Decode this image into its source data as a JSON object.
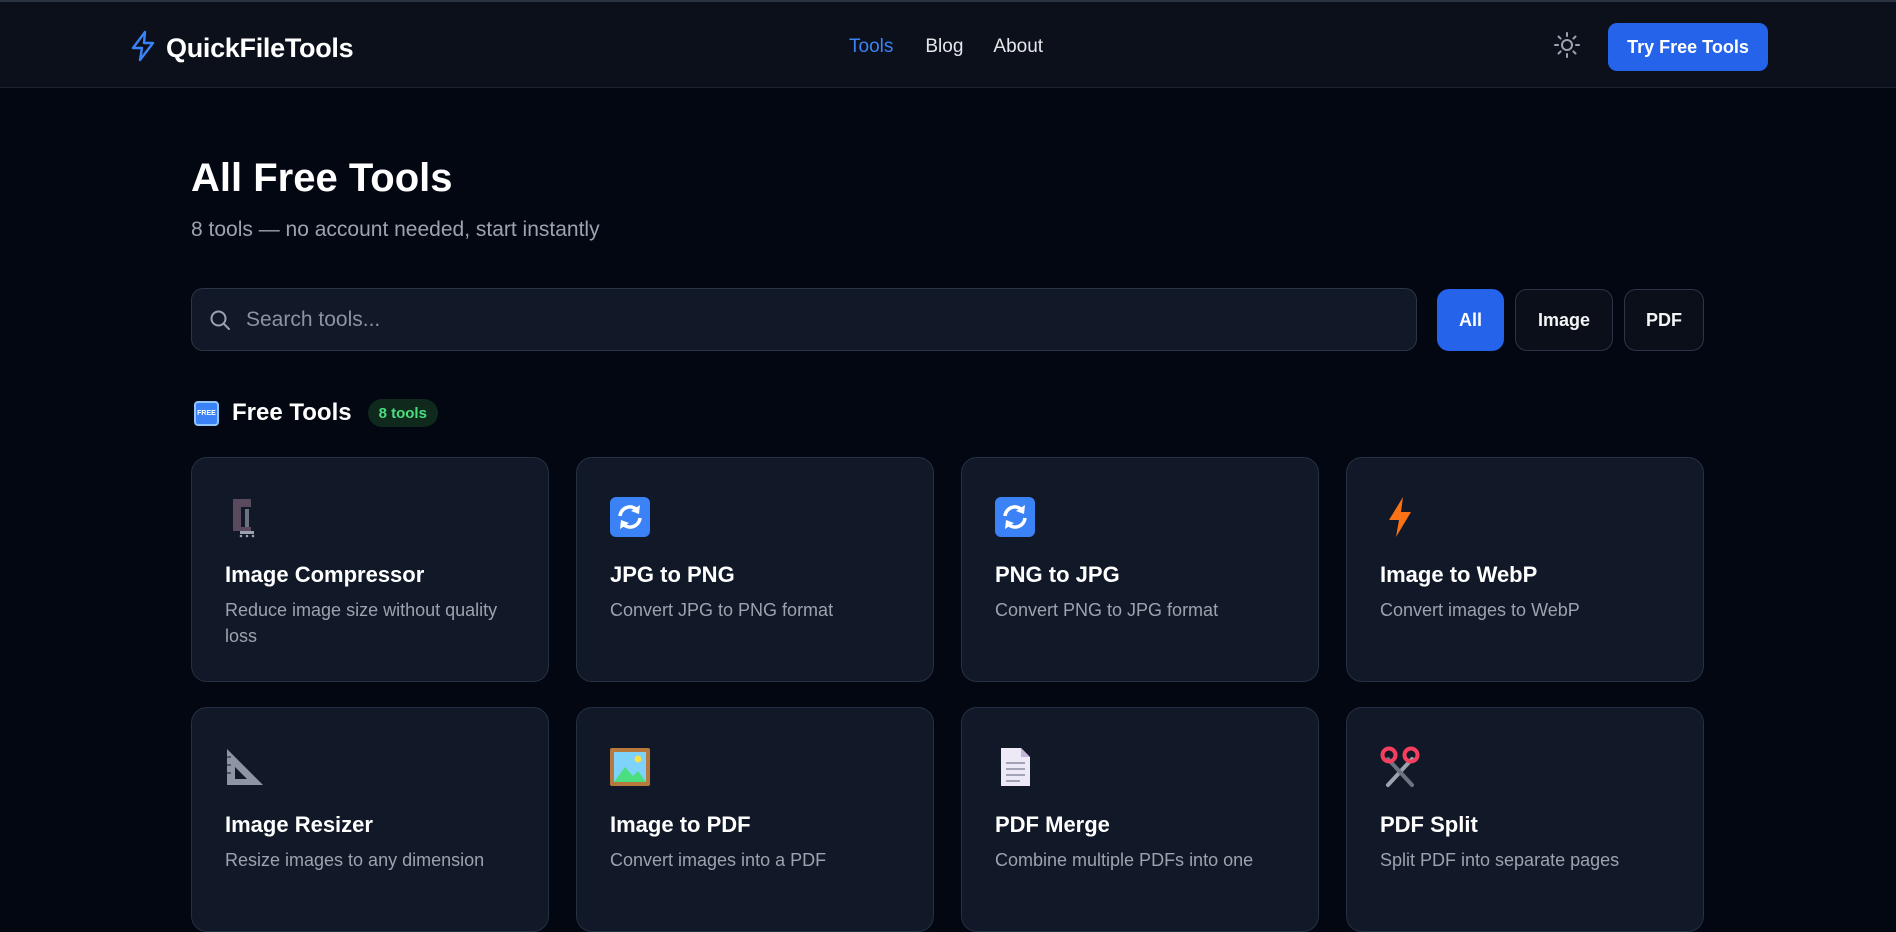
{
  "brand": {
    "name": "QuickFileTools",
    "accent": "#2563eb"
  },
  "nav": {
    "items": [
      "Tools",
      "Blog",
      "About"
    ],
    "active": "Tools"
  },
  "header": {
    "cta_label": "Try Free Tools",
    "theme_icon": "sun-icon"
  },
  "page": {
    "title": "All Free Tools",
    "subtitle": "8 tools — no account needed, start instantly"
  },
  "search": {
    "placeholder": "Search tools...",
    "value": ""
  },
  "filters": {
    "items": [
      "All",
      "Image",
      "PDF"
    ],
    "active": "All"
  },
  "section": {
    "badge_icon_text": "FREE",
    "title": "Free Tools",
    "count": "8 tools"
  },
  "tools": [
    {
      "name": "Image Compressor",
      "desc": "Reduce image size without quality loss",
      "icon": "clamp-icon"
    },
    {
      "name": "JPG to PNG",
      "desc": "Convert JPG to PNG format",
      "icon": "convert-arrows-icon"
    },
    {
      "name": "PNG to JPG",
      "desc": "Convert PNG to JPG format",
      "icon": "convert-arrows-icon"
    },
    {
      "name": "Image to WebP",
      "desc": "Convert images to WebP",
      "icon": "lightning-icon"
    },
    {
      "name": "Image Resizer",
      "desc": "Resize images to any dimension",
      "icon": "set-square-icon"
    },
    {
      "name": "Image to PDF",
      "desc": "Convert images into a PDF",
      "icon": "framed-picture-icon"
    },
    {
      "name": "PDF Merge",
      "desc": "Combine multiple PDFs into one",
      "icon": "document-icon"
    },
    {
      "name": "PDF Split",
      "desc": "Split PDF into separate pages",
      "icon": "scissors-icon"
    }
  ]
}
